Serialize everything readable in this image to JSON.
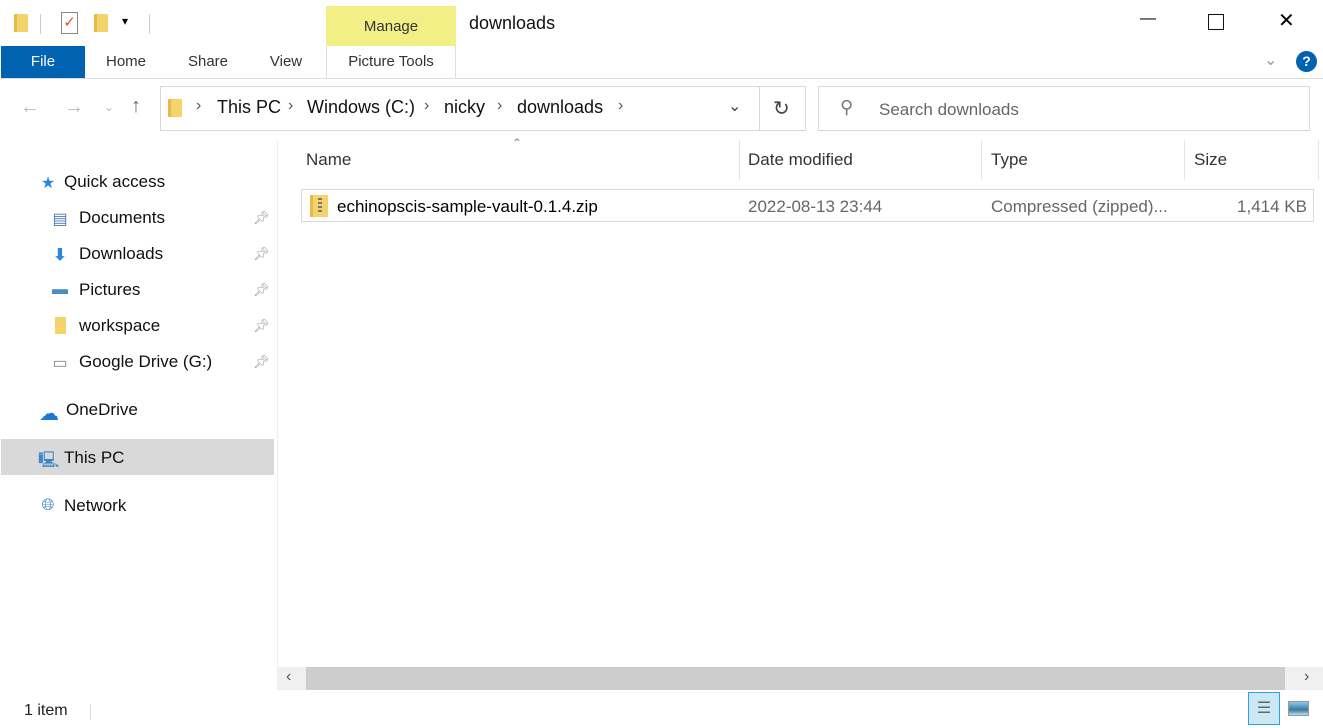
{
  "window": {
    "title": "downloads",
    "minimize": "—",
    "maximize": "☐",
    "close": "✕"
  },
  "ribbon": {
    "context_group": "Manage",
    "tabs": [
      {
        "label": "File"
      },
      {
        "label": "Home"
      },
      {
        "label": "Share"
      },
      {
        "label": "View"
      },
      {
        "label": "Picture Tools"
      }
    ],
    "help": "?"
  },
  "address": {
    "crumbs": [
      "This PC",
      "Windows (C:)",
      "nicky",
      "downloads"
    ]
  },
  "search": {
    "placeholder": "Search downloads"
  },
  "sidebar": {
    "items": [
      {
        "label": "Quick access",
        "icon": "star-icon"
      },
      {
        "label": "Documents",
        "icon": "documents-icon",
        "pinned": true
      },
      {
        "label": "Downloads",
        "icon": "download-arrow-icon",
        "pinned": true
      },
      {
        "label": "Pictures",
        "icon": "pictures-icon",
        "pinned": true
      },
      {
        "label": "workspace",
        "icon": "folder-icon",
        "pinned": true
      },
      {
        "label": "Google Drive (G:)",
        "icon": "drive-icon",
        "pinned": true
      },
      {
        "label": "OneDrive",
        "icon": "cloud-icon"
      },
      {
        "label": "This PC",
        "icon": "computer-icon",
        "selected": true
      },
      {
        "label": "Network",
        "icon": "network-icon"
      }
    ]
  },
  "columns": {
    "name": "Name",
    "date": "Date modified",
    "type": "Type",
    "size": "Size"
  },
  "files": [
    {
      "name": "echinopscis-sample-vault-0.1.4.zip",
      "date": "2022-08-13 23:44",
      "type": "Compressed (zipped)...",
      "size": "1,414 KB"
    }
  ],
  "status": {
    "count": "1 item"
  },
  "colors": {
    "accent": "#0063b1",
    "manage": "#f1ef85",
    "selected": "#d9d9d9"
  }
}
